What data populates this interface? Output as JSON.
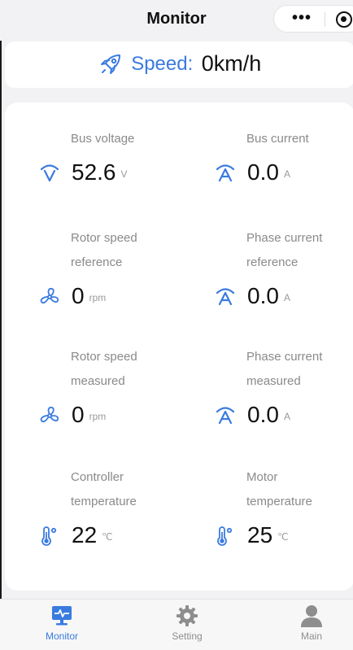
{
  "header": {
    "title": "Monitor",
    "more_icon": "more-dots-icon",
    "close_icon": "target-icon"
  },
  "speed": {
    "icon": "rocket-icon",
    "label": "Speed:",
    "value": "0km/h"
  },
  "metrics": [
    {
      "label_line1": "Bus voltage",
      "label_line2": "",
      "icon": "voltage-v-icon",
      "value": "52.6",
      "unit": "V"
    },
    {
      "label_line1": "Bus current",
      "label_line2": "",
      "icon": "current-a-icon",
      "value": "0.0",
      "unit": "A"
    },
    {
      "label_line1": "Rotor speed",
      "label_line2": "reference",
      "icon": "fan-icon",
      "value": "0",
      "unit": "rpm"
    },
    {
      "label_line1": "Phase current",
      "label_line2": "reference",
      "icon": "current-a-icon",
      "value": "0.0",
      "unit": "A"
    },
    {
      "label_line1": "Rotor speed",
      "label_line2": "measured",
      "icon": "fan-icon",
      "value": "0",
      "unit": "rpm"
    },
    {
      "label_line1": "Phase current",
      "label_line2": "measured",
      "icon": "current-a-icon",
      "value": "0.0",
      "unit": "A"
    },
    {
      "label_line1": "Controller",
      "label_line2": "temperature",
      "icon": "thermometer-icon",
      "value": "22",
      "unit": "℃"
    },
    {
      "label_line1": "Motor",
      "label_line2": "temperature",
      "icon": "thermometer-icon",
      "value": "25",
      "unit": "℃"
    }
  ],
  "tabbar": {
    "tabs": [
      {
        "label": "Monitor",
        "icon": "monitor-icon",
        "active": true
      },
      {
        "label": "Setting",
        "icon": "gear-icon",
        "active": false
      },
      {
        "label": "Main",
        "icon": "user-icon",
        "active": false
      }
    ]
  },
  "colors": {
    "accent": "#3a7be0",
    "label_gray": "#8a8a8a",
    "background": "#f2f2f4"
  }
}
